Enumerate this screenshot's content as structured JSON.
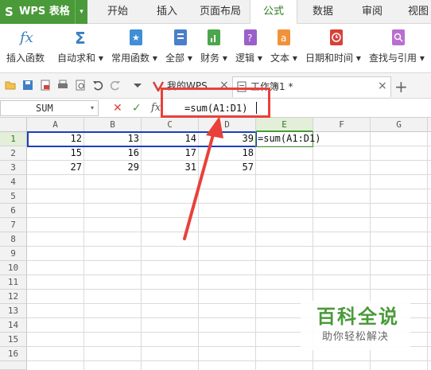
{
  "app": {
    "logo": "S",
    "title": "WPS 表格",
    "dropdown": "▾"
  },
  "menu": {
    "tabs": [
      "开始",
      "插入",
      "页面布局",
      "公式",
      "数据",
      "审阅",
      "视图"
    ],
    "active": "公式"
  },
  "ribbon": {
    "items": [
      {
        "label": "插入函数",
        "icon": "fx-icon"
      },
      {
        "label": "自动求和 ▾",
        "icon": "sigma-icon"
      },
      {
        "label": "常用函数 ▾",
        "icon": "star-book-icon"
      },
      {
        "label": "全部 ▾",
        "icon": "book-icon"
      },
      {
        "label": "财务 ▾",
        "icon": "finance-icon"
      },
      {
        "label": "逻辑 ▾",
        "icon": "question-icon"
      },
      {
        "label": "文本 ▾",
        "icon": "text-a-icon"
      },
      {
        "label": "日期和时间 ▾",
        "icon": "clock-icon"
      },
      {
        "label": "查找与引用 ▾",
        "icon": "search-book-icon"
      }
    ]
  },
  "doc_tabs": {
    "tab1": "我的WPS",
    "tab2": "工作簿1 *",
    "close": "×",
    "add": "+"
  },
  "formula_bar": {
    "name_box": "SUM",
    "cancel": "✕",
    "confirm": "✓",
    "fx": "fx",
    "formula": "=sum(A1:D1)"
  },
  "sheet": {
    "columns": [
      "A",
      "B",
      "C",
      "D",
      "E",
      "F",
      "G"
    ],
    "rows": [
      "1",
      "2",
      "3",
      "4",
      "5",
      "6",
      "7",
      "8",
      "9",
      "10",
      "11",
      "12",
      "13",
      "14",
      "15",
      "16"
    ],
    "cells": [
      [
        "12",
        "13",
        "14",
        "39"
      ],
      [
        "15",
        "16",
        "17",
        "18"
      ],
      [
        "27",
        "29",
        "31",
        "57"
      ]
    ],
    "editing_cell_text": "=sum(A1:D1)"
  },
  "watermark": {
    "title": "百科全说",
    "subtitle": "助你轻松解决"
  },
  "colors": {
    "accent": "#4a9a3a",
    "highlight_red": "#e8413a",
    "selection_blue": "#1b3fbf"
  }
}
